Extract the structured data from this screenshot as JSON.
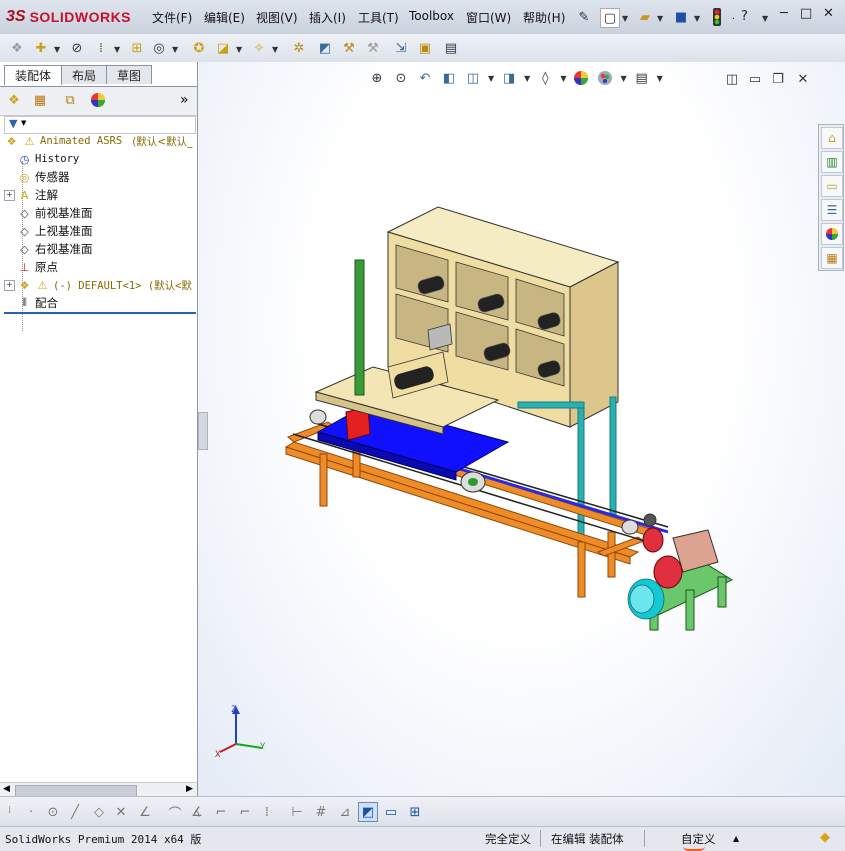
{
  "app": {
    "brand_prefix": "3S",
    "brand_name": "SOLIDWORKS"
  },
  "menu": [
    {
      "id": "file",
      "label": "文件(F)"
    },
    {
      "id": "edit",
      "label": "编辑(E)"
    },
    {
      "id": "view",
      "label": "视图(V)"
    },
    {
      "id": "insert",
      "label": "插入(I)"
    },
    {
      "id": "tools",
      "label": "工具(T)"
    },
    {
      "id": "toolbox",
      "label": "Toolbox"
    },
    {
      "id": "window",
      "label": "窗口(W)"
    },
    {
      "id": "help",
      "label": "帮助(H)"
    }
  ],
  "titlebar": {
    "help_glyph": "?",
    "min_glyph": "─",
    "max_glyph": "□",
    "close_glyph": "✕"
  },
  "left_panel": {
    "tabs": [
      "装配体",
      "布局",
      "草图"
    ],
    "active_tab": 0,
    "collapse_glyph": "»",
    "filter_glyph": "▼"
  },
  "tree": {
    "root": {
      "label": "Animated ASRS",
      "suffix": "(默认<默认_"
    },
    "items": [
      {
        "label": "History",
        "icon": "history-icon"
      },
      {
        "label": "传感器",
        "icon": "sensor-icon"
      },
      {
        "label": "注解",
        "icon": "annotation-icon",
        "expander": "+"
      },
      {
        "label": "前视基准面",
        "icon": "plane-icon"
      },
      {
        "label": "上视基准面",
        "icon": "plane-icon"
      },
      {
        "label": "右视基准面",
        "icon": "plane-icon"
      },
      {
        "label": "原点",
        "icon": "origin-icon"
      },
      {
        "label": "(-) DEFAULT<1> (默认<默",
        "icon": "warning-part-icon",
        "expander": "+"
      },
      {
        "label": "配合",
        "icon": "mates-icon"
      }
    ]
  },
  "triad": {
    "x": "X",
    "y": "Y",
    "z": "Z"
  },
  "status": {
    "app_version": "SolidWorks Premium 2014 x64 版",
    "definition": "完全定义",
    "editing": "在编辑 装配体",
    "custom": "自定义",
    "custom_caret": "▲"
  },
  "colors": {
    "frame_orange": "#f08c28",
    "platform_blue": "#1010ff",
    "shelf_tan": "#f1e2a6",
    "column_green": "#3a9a3a",
    "leg_teal": "#2ab0b0",
    "motor_cyan": "#14c8d4",
    "gearbox_tan": "#dca490",
    "coupling_red": "#e03040",
    "base_green": "#6ac86a"
  }
}
